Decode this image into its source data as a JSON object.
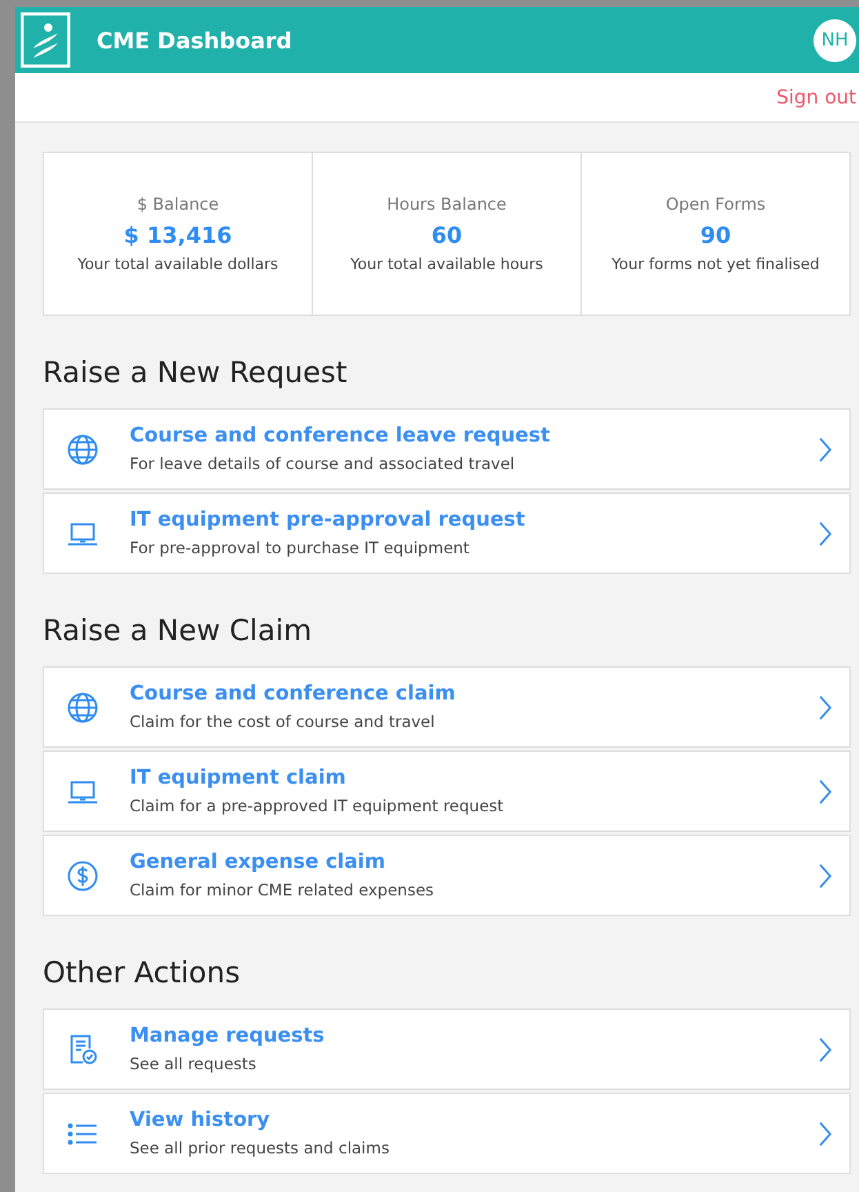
{
  "header": {
    "title": "CME Dashboard",
    "avatar": "NH",
    "sign_out": "Sign out"
  },
  "stats": [
    {
      "label": "$ Balance",
      "value": "$ 13,416",
      "caption": "Your total available dollars"
    },
    {
      "label": "Hours Balance",
      "value": "60",
      "caption": "Your total available hours"
    },
    {
      "label": "Open Forms",
      "value": "90",
      "caption": "Your forms not yet finalised"
    }
  ],
  "sections": [
    {
      "title": "Raise a New Request",
      "items": [
        {
          "kind": "globe",
          "title": "Course and conference leave request",
          "subtitle": "For leave details of course and associated travel"
        },
        {
          "kind": "laptop",
          "title": "IT equipment pre-approval request",
          "subtitle": "For pre-approval to purchase IT equipment"
        }
      ]
    },
    {
      "title": "Raise a New Claim",
      "items": [
        {
          "kind": "globe",
          "title": "Course and conference claim",
          "subtitle": "Claim for the cost of course and travel"
        },
        {
          "kind": "laptop",
          "title": "IT equipment claim",
          "subtitle": "Claim for a pre-approved IT equipment request"
        },
        {
          "kind": "dollar",
          "title": "General expense claim",
          "subtitle": "Claim for minor CME related expenses"
        }
      ]
    },
    {
      "title": "Other Actions",
      "items": [
        {
          "kind": "document",
          "title": "Manage requests",
          "subtitle": "See all requests"
        },
        {
          "kind": "list",
          "title": "View history",
          "subtitle": "See all prior requests and claims"
        }
      ]
    }
  ]
}
